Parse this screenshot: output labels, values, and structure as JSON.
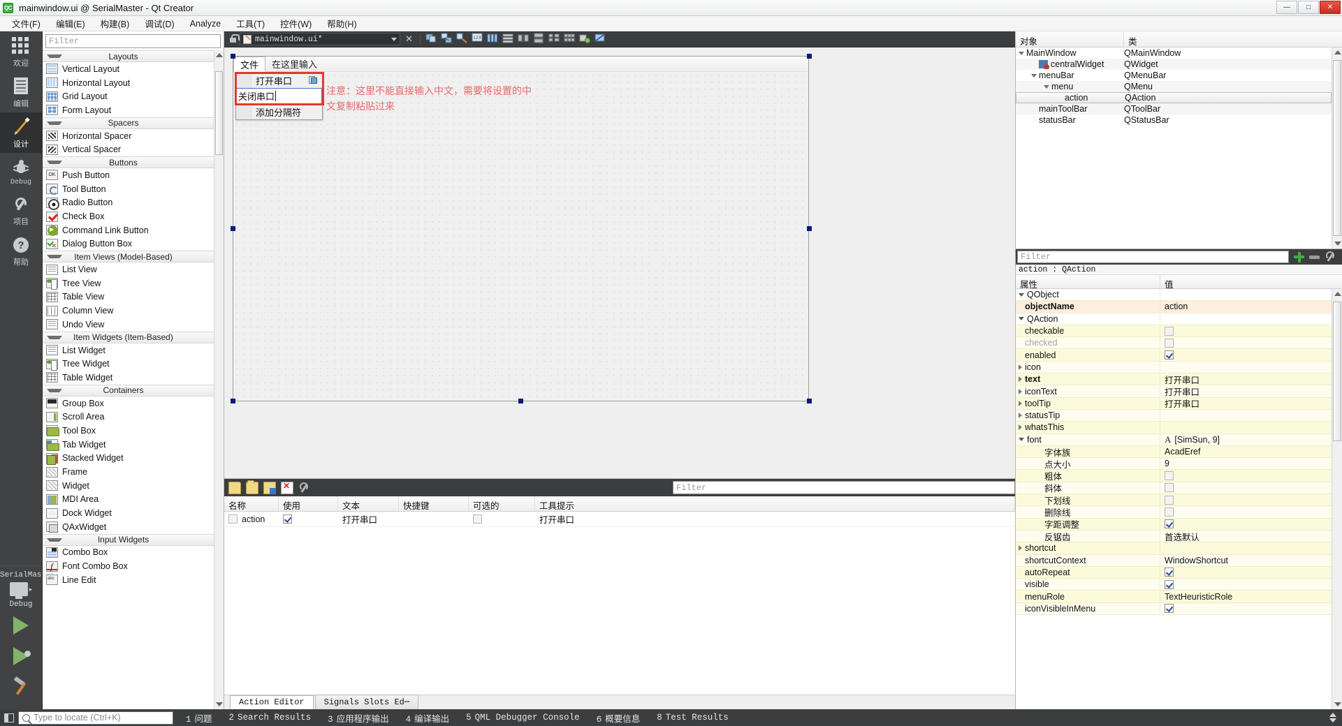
{
  "window": {
    "title": "mainwindow.ui @ SerialMaster - Qt Creator",
    "logo_text": "QC",
    "minimize": "—",
    "maximize": "□",
    "close": "✕"
  },
  "menubar": {
    "items": [
      {
        "label": "文件(F)",
        "name": "menu-file"
      },
      {
        "label": "编辑(E)",
        "name": "menu-edit"
      },
      {
        "label": "构建(B)",
        "name": "menu-build"
      },
      {
        "label": "调试(D)",
        "name": "menu-debug"
      },
      {
        "label": "Analyze",
        "name": "menu-analyze"
      },
      {
        "label": "工具(T)",
        "name": "menu-tools"
      },
      {
        "label": "控件(W)",
        "name": "menu-widgets"
      },
      {
        "label": "帮助(H)",
        "name": "menu-help"
      }
    ]
  },
  "modebar": {
    "items": [
      {
        "label": "欢迎",
        "icon": "grid-icon",
        "active": false
      },
      {
        "label": "编辑",
        "icon": "document-icon",
        "active": false
      },
      {
        "label": "设计",
        "icon": "pencil-icon",
        "active": true
      },
      {
        "label": "Debug",
        "icon": "bug-icon",
        "active": false
      },
      {
        "label": "项目",
        "icon": "wrench-icon",
        "active": false
      },
      {
        "label": "帮助",
        "icon": "question-circle-icon",
        "active": false
      }
    ],
    "kit": {
      "project": "SerialMaster",
      "build_config": "Debug",
      "monitor_icon": "monitor-icon",
      "arrow": "▸"
    },
    "run_buttons": [
      {
        "name": "run-button",
        "icon": "play-triangle-icon"
      },
      {
        "name": "debug-button",
        "icon": "play-debug-icon"
      },
      {
        "name": "build-button",
        "icon": "hammer-icon"
      }
    ]
  },
  "widgetbox": {
    "filter_placeholder": "Filter",
    "groups": [
      {
        "title": "Layouts",
        "items": [
          {
            "label": "Vertical Layout",
            "icon": "vertical-layout-icon",
            "cls": "wi-vl"
          },
          {
            "label": "Horizontal Layout",
            "icon": "horizontal-layout-icon",
            "cls": "wi-hl"
          },
          {
            "label": "Grid Layout",
            "icon": "grid-layout-icon",
            "cls": "wi-gl"
          },
          {
            "label": "Form Layout",
            "icon": "form-layout-icon",
            "cls": "wi-fl"
          }
        ]
      },
      {
        "title": "Spacers",
        "items": [
          {
            "label": "Horizontal Spacer",
            "icon": "horizontal-spacer-icon",
            "cls": "wi-hs"
          },
          {
            "label": "Vertical Spacer",
            "icon": "vertical-spacer-icon",
            "cls": "wi-vs"
          }
        ]
      },
      {
        "title": "Buttons",
        "items": [
          {
            "label": "Push Button",
            "icon": "push-button-icon",
            "cls": "wi-pb"
          },
          {
            "label": "Tool Button",
            "icon": "tool-button-icon",
            "cls": "wi-tb"
          },
          {
            "label": "Radio Button",
            "icon": "radio-button-icon",
            "cls": "wi-rb"
          },
          {
            "label": "Check Box",
            "icon": "check-box-icon",
            "cls": "wi-cb"
          },
          {
            "label": "Command Link Button",
            "icon": "command-link-icon",
            "cls": "wi-cl"
          },
          {
            "label": "Dialog Button Box",
            "icon": "dialog-button-box-icon",
            "cls": "wi-dbb"
          }
        ]
      },
      {
        "title": "Item Views (Model-Based)",
        "items": [
          {
            "label": "List View",
            "icon": "list-view-icon",
            "cls": "wi-lv"
          },
          {
            "label": "Tree View",
            "icon": "tree-view-icon",
            "cls": "wi-tv"
          },
          {
            "label": "Table View",
            "icon": "table-view-icon",
            "cls": "wi-tav"
          },
          {
            "label": "Column View",
            "icon": "column-view-icon",
            "cls": "wi-cv"
          },
          {
            "label": "Undo View",
            "icon": "undo-view-icon",
            "cls": "wi-lv"
          }
        ]
      },
      {
        "title": "Item Widgets (Item-Based)",
        "items": [
          {
            "label": "List Widget",
            "icon": "list-widget-icon",
            "cls": "wi-lv"
          },
          {
            "label": "Tree Widget",
            "icon": "tree-widget-icon",
            "cls": "wi-tv"
          },
          {
            "label": "Table Widget",
            "icon": "table-widget-icon",
            "cls": "wi-tav"
          }
        ]
      },
      {
        "title": "Containers",
        "items": [
          {
            "label": "Group Box",
            "icon": "group-box-icon",
            "cls": "wi-gb"
          },
          {
            "label": "Scroll Area",
            "icon": "scroll-area-icon",
            "cls": "wi-sa"
          },
          {
            "label": "Tool Box",
            "icon": "tool-box-icon",
            "cls": "wi-tbx"
          },
          {
            "label": "Tab Widget",
            "icon": "tab-widget-icon",
            "cls": "wi-tab"
          },
          {
            "label": "Stacked Widget",
            "icon": "stacked-widget-icon",
            "cls": "wi-sw"
          },
          {
            "label": "Frame",
            "icon": "frame-icon",
            "cls": "wi-fr"
          },
          {
            "label": "Widget",
            "icon": "widget-icon",
            "cls": "wi-fr"
          },
          {
            "label": "MDI Area",
            "icon": "mdi-area-icon",
            "cls": "wi-mdi"
          },
          {
            "label": "Dock Widget",
            "icon": "dock-widget-icon",
            "cls": "wi-dw"
          },
          {
            "label": "QAxWidget",
            "icon": "qax-widget-icon",
            "cls": "wi-qax"
          }
        ]
      },
      {
        "title": "Input Widgets",
        "items": [
          {
            "label": "Combo Box",
            "icon": "combo-box-icon",
            "cls": "wi-cmb"
          },
          {
            "label": "Font Combo Box",
            "icon": "font-combo-box-icon",
            "cls": "wi-fcb"
          },
          {
            "label": "Line Edit",
            "icon": "line-edit-icon",
            "cls": "wi-le"
          }
        ]
      }
    ]
  },
  "editor_toolbar": {
    "file_name": "mainwindow.ui*",
    "close_label": "✕",
    "lock_icon": "lock-open-icon",
    "dropdown_icon": "chevron-down-icon",
    "buttons": [
      {
        "name": "edit-widgets-button",
        "icon": "edit-widgets-icon"
      },
      {
        "name": "edit-signals-slots-button",
        "icon": "edit-signals-slots-icon"
      },
      {
        "name": "edit-buddies-button",
        "icon": "edit-buddies-icon"
      },
      {
        "name": "edit-tab-order-button",
        "icon": "edit-tab-order-icon"
      },
      {
        "name": "layout-horizontally-button",
        "icon": "layout-horizontal-icon"
      },
      {
        "name": "layout-vertically-button",
        "icon": "layout-vertical-icon"
      },
      {
        "name": "layout-splitter-h-button",
        "icon": "splitter-horizontal-icon"
      },
      {
        "name": "layout-splitter-v-button",
        "icon": "splitter-vertical-icon"
      },
      {
        "name": "layout-form-button",
        "icon": "layout-form-icon"
      },
      {
        "name": "layout-grid-button",
        "icon": "layout-grid-icon"
      },
      {
        "name": "break-layout-button",
        "icon": "break-layout-icon"
      },
      {
        "name": "adjust-size-button",
        "icon": "adjust-size-icon"
      }
    ]
  },
  "form": {
    "menubar_items": [
      {
        "label": "文件",
        "selected": true
      },
      {
        "label": "在这里输入",
        "selected": false
      }
    ],
    "dropdown": {
      "rows": [
        {
          "label": "打开串口",
          "icon": "paste-icon"
        },
        {
          "label": "添加分隔符",
          "icon": ""
        }
      ],
      "editing_value": "关闭串口"
    },
    "hint": "注意：这里不能直接输入中文，需要将设置的中\n文复制粘贴过来"
  },
  "action_editor": {
    "filter_placeholder": "Filter",
    "toolbar_icons": [
      {
        "name": "new-action-button",
        "icon": "new-document-icon"
      },
      {
        "name": "open-action-button",
        "icon": "folder-icon"
      },
      {
        "name": "edit-action-button",
        "icon": "folder-edit-icon"
      },
      {
        "name": "delete-action-button",
        "icon": "delete-x-icon"
      },
      {
        "name": "configure-action-button",
        "icon": "wrench-icon"
      }
    ],
    "columns": [
      "名称",
      "使用",
      "文本",
      "快捷键",
      "可选的",
      "工具提示"
    ],
    "rows": [
      {
        "name": "action",
        "used": true,
        "text": "打开串口",
        "shortcut": "",
        "checkable": false,
        "tooltip": "打开串口"
      }
    ],
    "tabs": [
      {
        "label": "Action Editor",
        "active": true
      },
      {
        "label": "Signals  Slots Ed⋯",
        "active": false
      }
    ]
  },
  "object_inspector": {
    "columns": [
      "对象",
      "类"
    ],
    "rows": [
      {
        "name": "MainWindow",
        "class": "QMainWindow",
        "indent": 0,
        "twisty": "down",
        "icon": false,
        "selected": false
      },
      {
        "name": "centralWidget",
        "class": "QWidget",
        "indent": 1,
        "twisty": "none",
        "icon": true,
        "selected": false
      },
      {
        "name": "menuBar",
        "class": "QMenuBar",
        "indent": 1,
        "twisty": "down",
        "icon": false,
        "selected": false
      },
      {
        "name": "menu",
        "class": "QMenu",
        "indent": 2,
        "twisty": "down",
        "icon": false,
        "selected": false
      },
      {
        "name": "action",
        "class": "QAction",
        "indent": 3,
        "twisty": "none",
        "icon": false,
        "selected": true
      },
      {
        "name": "mainToolBar",
        "class": "QToolBar",
        "indent": 1,
        "twisty": "none",
        "icon": false,
        "selected": false
      },
      {
        "name": "statusBar",
        "class": "QStatusBar",
        "indent": 1,
        "twisty": "none",
        "icon": false,
        "selected": false
      }
    ]
  },
  "property_editor": {
    "filter_placeholder": "Filter",
    "object_line": "action : QAction",
    "columns": [
      "属性",
      "值"
    ],
    "add_icon": "plus-icon",
    "remove_icon": "minus-icon",
    "config_icon": "wrench-icon",
    "rows": [
      {
        "key": "QObject",
        "value": "",
        "type": "group",
        "indent": 0,
        "twisty": "down"
      },
      {
        "key": "objectName",
        "value": "action",
        "type": "hl",
        "indent": 0,
        "twisty": "none",
        "bold": true
      },
      {
        "key": "QAction",
        "value": "",
        "type": "group",
        "indent": 0,
        "twisty": "down"
      },
      {
        "key": "checkable",
        "value": "",
        "type": "y1",
        "indent": 0,
        "twisty": "none",
        "check": "unchecked"
      },
      {
        "key": "checked",
        "value": "",
        "type": "y2",
        "indent": 0,
        "twisty": "none",
        "check": "unchecked",
        "dim": true
      },
      {
        "key": "enabled",
        "value": "",
        "type": "y1",
        "indent": 0,
        "twisty": "none",
        "check": "checked"
      },
      {
        "key": "icon",
        "value": "",
        "type": "y2",
        "indent": 0,
        "twisty": "right"
      },
      {
        "key": "text",
        "value": "打开串口",
        "type": "y1",
        "indent": 0,
        "twisty": "right",
        "bold": true
      },
      {
        "key": "iconText",
        "value": "打开串口",
        "type": "y2",
        "indent": 0,
        "twisty": "right"
      },
      {
        "key": "toolTip",
        "value": "打开串口",
        "type": "y1",
        "indent": 0,
        "twisty": "right"
      },
      {
        "key": "statusTip",
        "value": "",
        "type": "y2",
        "indent": 0,
        "twisty": "right"
      },
      {
        "key": "whatsThis",
        "value": "",
        "type": "y1",
        "indent": 0,
        "twisty": "right"
      },
      {
        "key": "font",
        "value": "[SimSun, 9]",
        "type": "y2",
        "indent": 0,
        "twisty": "down",
        "font_glyph": "A"
      },
      {
        "key": "字体族",
        "value": "AcadEref",
        "type": "y1",
        "indent": 2,
        "twisty": "none"
      },
      {
        "key": "点大小",
        "value": "9",
        "type": "y2",
        "indent": 2,
        "twisty": "none"
      },
      {
        "key": "粗体",
        "value": "",
        "type": "y1",
        "indent": 2,
        "twisty": "none",
        "check": "unchecked"
      },
      {
        "key": "斜体",
        "value": "",
        "type": "y2",
        "indent": 2,
        "twisty": "none",
        "check": "unchecked"
      },
      {
        "key": "下划线",
        "value": "",
        "type": "y1",
        "indent": 2,
        "twisty": "none",
        "check": "unchecked"
      },
      {
        "key": "删除线",
        "value": "",
        "type": "y2",
        "indent": 2,
        "twisty": "none",
        "check": "unchecked"
      },
      {
        "key": "字距调整",
        "value": "",
        "type": "y1",
        "indent": 2,
        "twisty": "none",
        "check": "checked"
      },
      {
        "key": "反锯齿",
        "value": "首选默认",
        "type": "y2",
        "indent": 2,
        "twisty": "none"
      },
      {
        "key": "shortcut",
        "value": "",
        "type": "y1",
        "indent": 0,
        "twisty": "right"
      },
      {
        "key": "shortcutContext",
        "value": "WindowShortcut",
        "type": "y2",
        "indent": 0,
        "twisty": "none"
      },
      {
        "key": "autoRepeat",
        "value": "",
        "type": "y1",
        "indent": 0,
        "twisty": "none",
        "check": "checked"
      },
      {
        "key": "visible",
        "value": "",
        "type": "y2",
        "indent": 0,
        "twisty": "none",
        "check": "checked"
      },
      {
        "key": "menuRole",
        "value": "TextHeuristicRole",
        "type": "y1",
        "indent": 0,
        "twisty": "none"
      },
      {
        "key": "iconVisibleInMenu",
        "value": "",
        "type": "y2",
        "indent": 0,
        "twisty": "none",
        "check": "checked"
      }
    ]
  },
  "statusbar": {
    "locate_placeholder": "Type to locate (Ctrl+K)",
    "search_icon": "search-icon",
    "panel_icon": "output-panel-icon",
    "items": [
      {
        "num": "1",
        "label": "问题"
      },
      {
        "num": "2",
        "label": "Search Results"
      },
      {
        "num": "3",
        "label": "应用程序输出"
      },
      {
        "num": "4",
        "label": "编译输出"
      },
      {
        "num": "5",
        "label": "QML Debugger Console"
      },
      {
        "num": "6",
        "label": "概要信息"
      },
      {
        "num": "8",
        "label": "Test Results"
      }
    ]
  }
}
